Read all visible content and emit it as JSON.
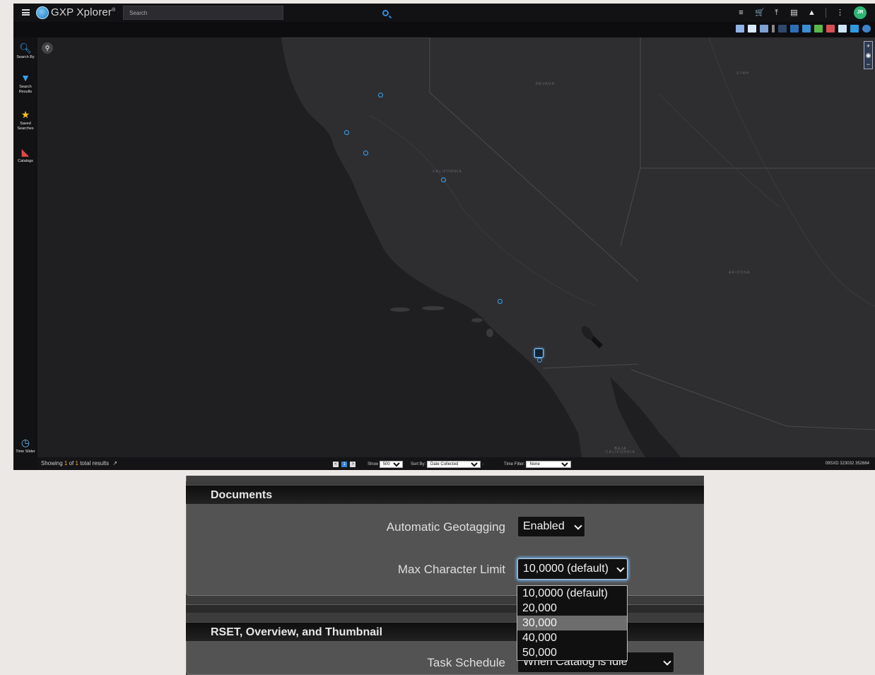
{
  "app": {
    "title": "GXP Xplorer",
    "title_mark": "®",
    "search_placeholder": "Search",
    "user_initials": "JR"
  },
  "sidebar": {
    "items": [
      {
        "label": "Search By",
        "icon": "magnifier-icon"
      },
      {
        "label": "Search Results",
        "icon": "funnel-icon"
      },
      {
        "label": "Saved Searches",
        "icon": "star-icon"
      },
      {
        "label": "Catalogs",
        "icon": "catalog-icon"
      },
      {
        "label": "Time Slider",
        "icon": "clock-icon"
      }
    ]
  },
  "map": {
    "labels": {
      "nevada": "NEVADA",
      "utah": "UTAH",
      "california": "CALIFORNIA",
      "arizona": "ARIZONA",
      "baja": "BAJA CALIFORNIA"
    }
  },
  "status": {
    "showing_prefix": "Showing",
    "showing_count": "1",
    "of_label": "of",
    "total_count": "1",
    "total_suffix": "total results",
    "page_prev": "<",
    "page_current": "1",
    "page_next": ">",
    "show_label": "Show",
    "show_value": "500",
    "sort_label": "Sort By:",
    "sort_value": "Date Collected",
    "time_filter_label": "Time Filter:",
    "time_filter_value": "None",
    "coords": "09SXD 323032 352664"
  },
  "settings": {
    "documents": {
      "header": "Documents",
      "auto_geotag_label": "Automatic Geotagging",
      "auto_geotag_value": "Enabled",
      "max_char_label": "Max Character Limit",
      "max_char_value": "10,0000 (default)",
      "max_char_options": [
        "10,0000 (default)",
        "20,000",
        "30,000",
        "40,000",
        "50,000"
      ]
    },
    "rset": {
      "header": "RSET, Overview, and Thumbnail",
      "task_schedule_label": "Task Schedule",
      "task_schedule_value": "When Catalog is Idle"
    }
  }
}
